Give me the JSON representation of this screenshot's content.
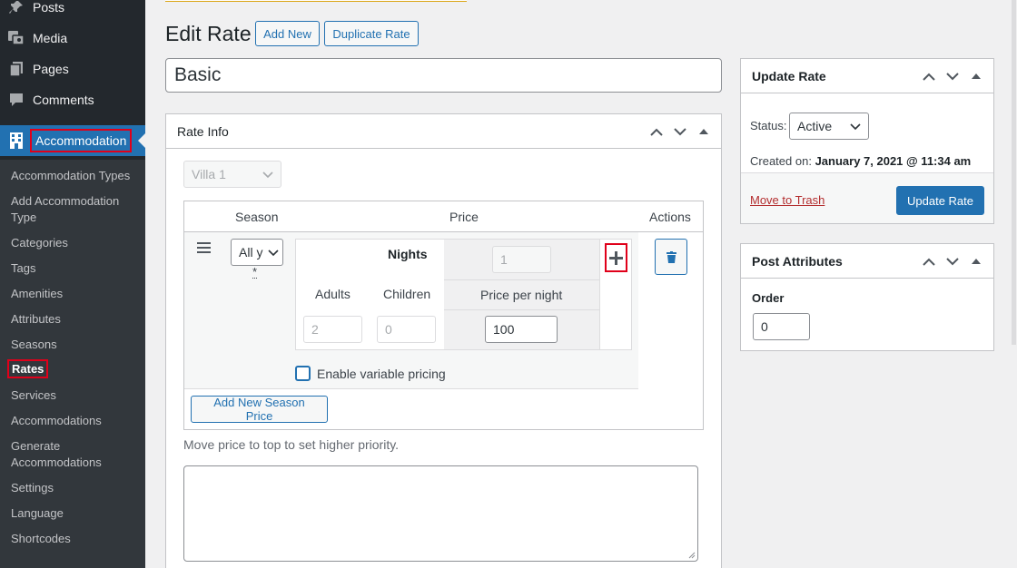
{
  "sidebar": {
    "menu": [
      {
        "label": "Posts",
        "icon": "pin-icon"
      },
      {
        "label": "Media",
        "icon": "media-icon"
      },
      {
        "label": "Pages",
        "icon": "pages-icon"
      },
      {
        "label": "Comments",
        "icon": "comments-icon"
      },
      {
        "label": "Accommodation",
        "icon": "building-icon"
      }
    ],
    "submenu": [
      "Accommodation Types",
      "Add Accommodation Type",
      "Categories",
      "Tags",
      "Amenities",
      "Attributes",
      "Seasons",
      "Rates",
      "Services",
      "Accommodations",
      "Generate Accommodations",
      "Settings",
      "Language",
      "Shortcodes"
    ]
  },
  "header": {
    "title": "Edit Rate",
    "add_new": "Add New",
    "duplicate": "Duplicate Rate"
  },
  "rate_title": "Basic",
  "rate_info": {
    "title": "Rate Info",
    "accommodation_select": "Villa 1",
    "columns": {
      "season": "Season",
      "price": "Price",
      "actions": "Actions"
    },
    "season_select": "All y",
    "required_mark": "*",
    "nights_label": "Nights",
    "nights_value": "1",
    "adults_label": "Adults",
    "children_label": "Children",
    "price_per_night_label": "Price per night",
    "adults_value": "2",
    "children_value": "0",
    "price_value": "100",
    "enable_variable_pricing": "Enable variable pricing",
    "add_season_price": "Add New Season Price",
    "priority_note": "Move price to top to set higher priority."
  },
  "update_box": {
    "title": "Update Rate",
    "status_label": "Status:",
    "status_value": "Active",
    "created_label": "Created on:",
    "created_value": "January 7, 2021 @ 11:34 am",
    "trash": "Move to Trash",
    "update_button": "Update Rate"
  },
  "attributes_box": {
    "title": "Post Attributes",
    "order_label": "Order",
    "order_value": "0"
  },
  "colors": {
    "sidebar_bg": "#23282d",
    "submenu_bg": "#32373c",
    "accent": "#2271b1",
    "highlight_red": "#e0001a",
    "trash_red": "#b32d2e"
  }
}
